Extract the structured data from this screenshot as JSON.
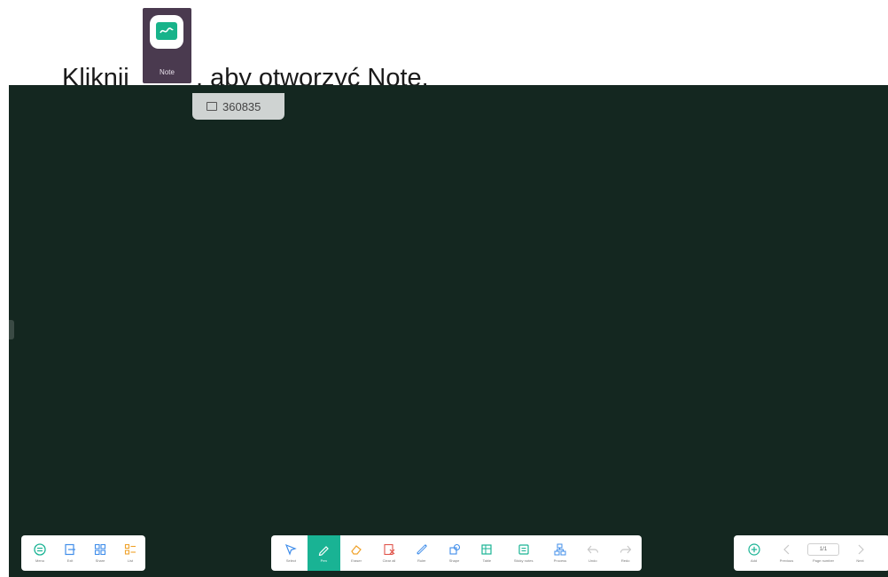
{
  "instruction": {
    "prefix": "Kliknij",
    "suffix": ", aby otworzyć Note.",
    "app_icon_caption": "Note"
  },
  "board": {
    "id_badge": "360835",
    "background_color": "#142720"
  },
  "toolbar_left": [
    {
      "name": "menu",
      "label": "Menu",
      "icon": "menu-circle-icon"
    },
    {
      "name": "exit",
      "label": "Exit",
      "icon": "exit-icon"
    },
    {
      "name": "share",
      "label": "Share",
      "icon": "qr-grid-icon"
    },
    {
      "name": "list",
      "label": "List",
      "icon": "list-icon"
    }
  ],
  "toolbar_middle": [
    {
      "name": "select",
      "label": "Select",
      "icon": "cursor-icon"
    },
    {
      "name": "pen",
      "label": "Pen",
      "icon": "pen-icon",
      "active": true
    },
    {
      "name": "eraser",
      "label": "Eraser",
      "icon": "eraser-icon"
    },
    {
      "name": "clear-all",
      "label": "Clear all",
      "icon": "clear-all-icon"
    },
    {
      "name": "ruler",
      "label": "Ruler",
      "icon": "ruler-icon"
    },
    {
      "name": "shape",
      "label": "Shape",
      "icon": "shape-icon"
    },
    {
      "name": "table",
      "label": "Table",
      "icon": "table-icon"
    },
    {
      "name": "sticky-notes",
      "label": "Sticky notes",
      "icon": "sticky-note-icon"
    },
    {
      "name": "process",
      "label": "Process",
      "icon": "process-icon"
    },
    {
      "name": "undo",
      "label": "Undo",
      "icon": "undo-icon",
      "disabled": true
    },
    {
      "name": "redo",
      "label": "Redo",
      "icon": "redo-icon",
      "disabled": true
    }
  ],
  "toolbar_right": [
    {
      "name": "add",
      "label": "Add",
      "icon": "plus-circle-icon"
    },
    {
      "name": "previous",
      "label": "Previous",
      "icon": "chevron-left-icon",
      "disabled": true
    },
    {
      "name": "page-number",
      "label": "Page number",
      "value": "1/1"
    },
    {
      "name": "next",
      "label": "Next",
      "icon": "chevron-right-icon",
      "disabled": true
    }
  ]
}
